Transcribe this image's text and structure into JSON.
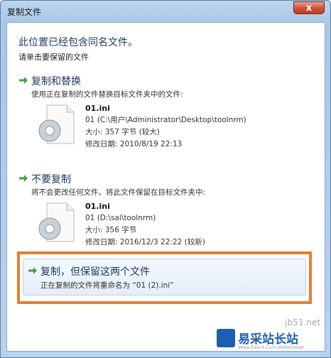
{
  "window": {
    "title": "复制文件",
    "close_label": "x"
  },
  "dialog": {
    "heading": "此位置已经包含同名文件。",
    "subheading": "请单击要保留的文件"
  },
  "options": [
    {
      "title": "复制和替换",
      "description": "使用正在复制的文件替换目标文件夹中的文件:",
      "file": {
        "name": "01.ini",
        "location": "01 (C:\\用户\\Administrator\\Desktop\\toolnrm)",
        "size": "大小: 357 字节 (较大)",
        "modified": "修改日期: 2010/8/19 22:13"
      }
    },
    {
      "title": "不要复制",
      "description": "将不会更改任何文件。将此文件保留在目标文件夹中:",
      "file": {
        "name": "01.ini",
        "location": "01 (D:\\sai\\toolnrm)",
        "size": "大小: 356 字节",
        "modified": "修改日期: 2016/12/3 22:22 (较新)"
      }
    },
    {
      "title": "复制，但保留这两个文件",
      "description": "正在复制的文件将重命名为 “01 (2).ini”"
    }
  ],
  "watermark": {
    "url": "jb51.net",
    "name": "易采站长站",
    "sub": "Www.Easck.Com Webmaster"
  },
  "colors": {
    "accent_arrow": "#3aa23a",
    "highlight_border": "#e47f30",
    "heading": "#1e395b"
  }
}
